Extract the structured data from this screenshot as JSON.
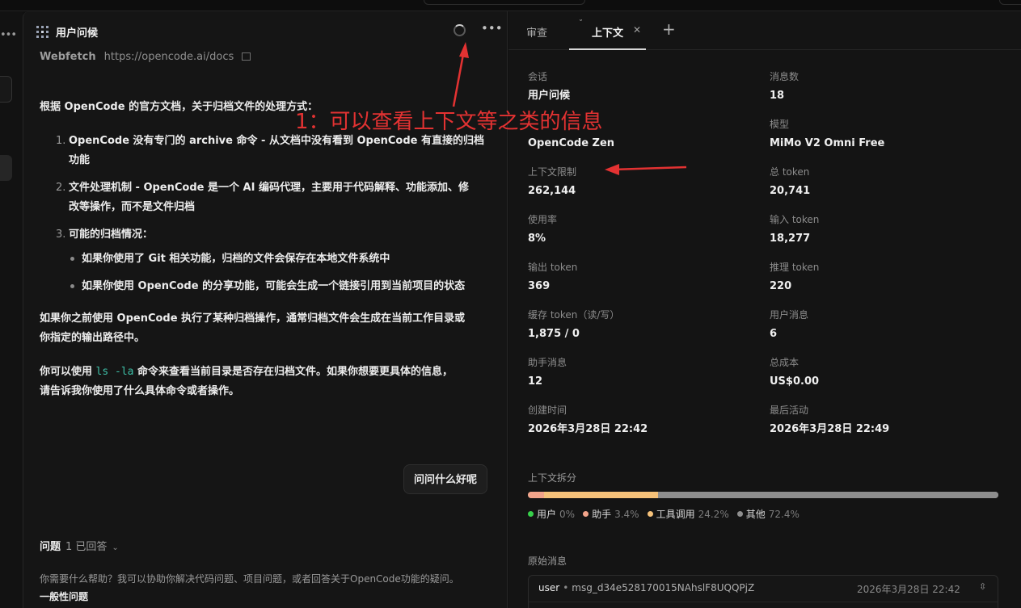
{
  "chat": {
    "title": "用户问候",
    "webfetch_label": "Webfetch",
    "webfetch_url": "https://opencode.ai/docs",
    "intro": "根据 OpenCode 的官方文档，关于归档文件的处理方式：",
    "list": [
      {
        "num": "1.",
        "line1": "OpenCode 没有专门的 archive 命令 - 从文档中没有看到 OpenCode 有直接的归档",
        "line2": "功能"
      },
      {
        "num": "2.",
        "line1": "文件处理机制 - OpenCode 是一个 AI 编码代理，主要用于代码解释、功能添加、修",
        "line2": "改等操作，而不是文件归档"
      },
      {
        "num": "3.",
        "line1": "可能的归档情况：",
        "line2": ""
      }
    ],
    "bullets": [
      "如果你使用了 Git 相关功能，归档的文件会保存在本地文件系统中",
      "如果你使用 OpenCode 的分享功能，可能会生成一个链接引用到当前项目的状态"
    ],
    "para1_line1": "如果你之前使用 OpenCode 执行了某种归档操作，通常归档文件会生成在当前工作目录或",
    "para1_line2": "你指定的输出路径中。",
    "para2_pre": "你可以使用",
    "para2_code": "ls -la",
    "para2_post": "命令来查看当前目录是否存在归档文件。如果你想要更具体的信息，",
    "para2_line2": "请告诉我你使用了什么具体命令或者操作。",
    "user_message": "问问什么好呢",
    "question_label": "问题",
    "question_count": "1 已回答",
    "question_help": "你需要什么帮助？我可以协助你解决代码问题、项目问题，或者回答关于OpenCode功能的疑问。",
    "question_general": "一般性问题"
  },
  "panel": {
    "tabs": {
      "review": "审查",
      "context": "上下文"
    },
    "stats": {
      "session_k": "会话",
      "session_v": "用户问候",
      "messages_k": "消息数",
      "messages_v": "18",
      "provider_v": "OpenCode Zen",
      "model_k": "模型",
      "model_v": "MiMo V2 Omni Free",
      "ctx_limit_k": "上下文限制",
      "ctx_limit_v": "262,144",
      "total_token_k": "总 token",
      "total_token_v": "20,741",
      "usage_k": "使用率",
      "usage_v": "8%",
      "input_k": "输入 token",
      "input_v": "18,277",
      "output_k": "输出 token",
      "output_v": "369",
      "reason_k": "推理 token",
      "reason_v": "220",
      "cache_k": "缓存 token（读/写）",
      "cache_v": "1,875 / 0",
      "user_msgs_k": "用户消息",
      "user_msgs_v": "6",
      "assistant_msgs_k": "助手消息",
      "assistant_msgs_v": "12",
      "cost_k": "总成本",
      "cost_v": "US$0.00",
      "created_k": "创建时间",
      "created_v": "2026年3月28日 22:42",
      "last_k": "最后活动",
      "last_v": "2026年3月28日 22:49"
    },
    "breakdown_title": "上下文拆分",
    "breakdown": [
      {
        "label": "用户",
        "pct": "0%",
        "value": 0,
        "color": "#37d04a"
      },
      {
        "label": "助手",
        "pct": "3.4%",
        "value": 3.4,
        "color": "#f2a48a"
      },
      {
        "label": "工具调用",
        "pct": "24.2%",
        "value": 24.2,
        "color": "#f6c27a"
      },
      {
        "label": "其他",
        "pct": "72.4%",
        "value": 72.4,
        "color": "#8e8e8e"
      }
    ],
    "raw_title": "原始消息",
    "raw": {
      "role": "user",
      "sep": "•",
      "id": "msg_d34e528170015NAhslF8UQQPjZ",
      "time": "2026年3月28日 22:42"
    }
  },
  "annotation": {
    "text": "1：可以查看上下文等之类的信息",
    "color": "#e33232"
  }
}
